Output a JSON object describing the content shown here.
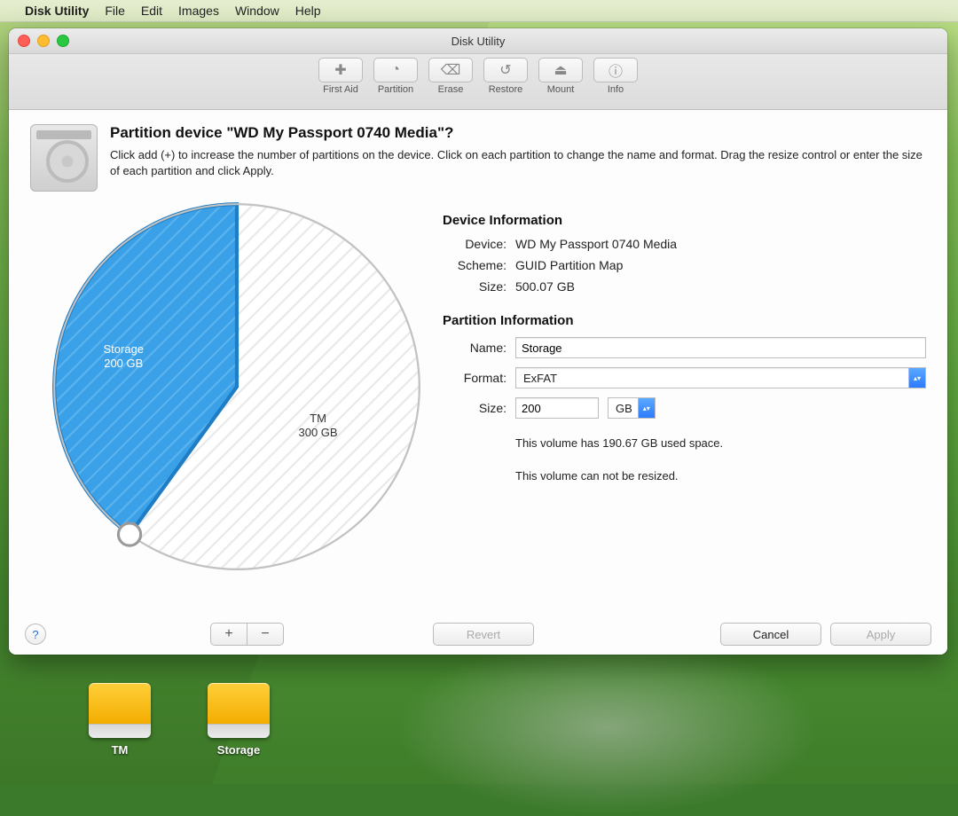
{
  "menubar": {
    "app_name": "Disk Utility",
    "items": [
      "File",
      "Edit",
      "Images",
      "Window",
      "Help"
    ]
  },
  "window": {
    "title": "Disk Utility"
  },
  "toolbar": {
    "items": [
      {
        "label": "First Aid",
        "icon": "stethoscope-icon"
      },
      {
        "label": "Partition",
        "icon": "pie-icon"
      },
      {
        "label": "Erase",
        "icon": "erase-icon"
      },
      {
        "label": "Restore",
        "icon": "restore-icon"
      },
      {
        "label": "Mount",
        "icon": "mount-icon"
      },
      {
        "label": "Info",
        "icon": "info-icon"
      }
    ]
  },
  "dialog": {
    "heading": "Partition device \"WD My Passport 0740 Media\"?",
    "instructions": "Click add (+) to increase the number of partitions on the device. Click on each partition to change the name and format. Drag the resize control or enter the size of each partition and click Apply."
  },
  "device_info": {
    "section_title": "Device Information",
    "device_label": "Device:",
    "device_value": "WD My Passport 0740 Media",
    "scheme_label": "Scheme:",
    "scheme_value": "GUID Partition Map",
    "size_label": "Size:",
    "size_value": "500.07 GB"
  },
  "partition_info": {
    "section_title": "Partition Information",
    "name_label": "Name:",
    "name_value": "Storage",
    "format_label": "Format:",
    "format_value": "ExFAT",
    "size_label": "Size:",
    "size_value": "200",
    "size_unit": "GB",
    "note1": "This volume has 190.67 GB used space.",
    "note2": "This volume can not be resized."
  },
  "chart_data": {
    "type": "pie",
    "title": "",
    "slices": [
      {
        "name": "Storage",
        "size_label": "200 GB",
        "value": 200,
        "color": "#3aa0e7",
        "selected": true
      },
      {
        "name": "TM",
        "size_label": "300 GB",
        "value": 300,
        "color": "#ffffff",
        "selected": false
      }
    ],
    "total": 500,
    "unit": "GB"
  },
  "buttons": {
    "help": "?",
    "add": "+",
    "remove": "−",
    "revert": "Revert",
    "cancel": "Cancel",
    "apply": "Apply"
  },
  "desktop_drives": [
    {
      "label": "TM"
    },
    {
      "label": "Storage"
    }
  ]
}
